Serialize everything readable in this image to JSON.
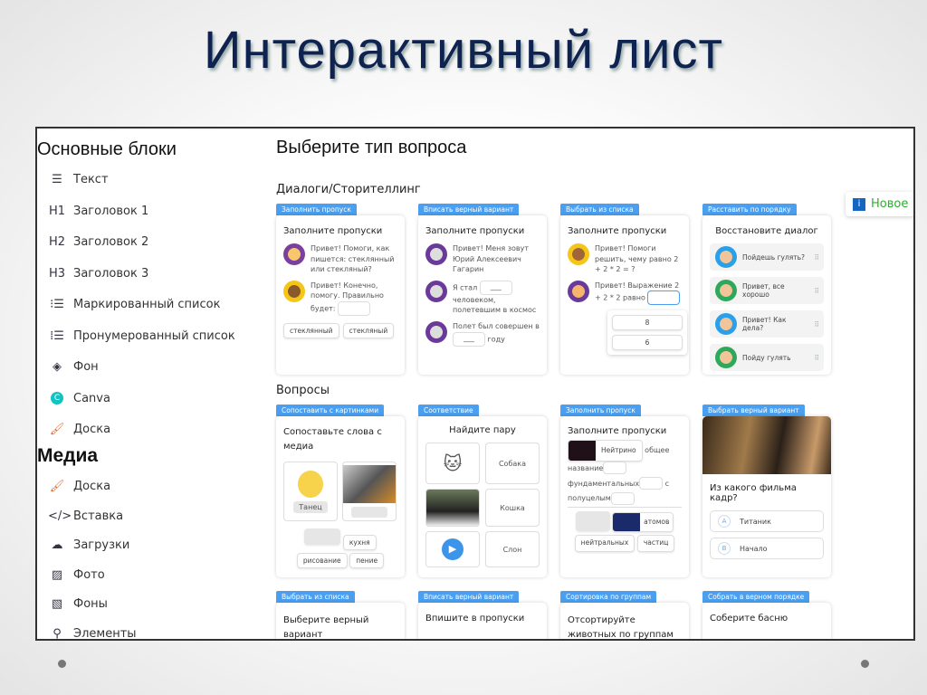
{
  "slide_title": "Интерактивный лист",
  "sidebar": {
    "basic_heading": "Основные блоки",
    "basic_items": [
      {
        "icon": "text-align-icon",
        "glyph": "☰",
        "label": "Текст"
      },
      {
        "icon": "h1-icon",
        "glyph": "H1",
        "label": "Заголовок 1"
      },
      {
        "icon": "h2-icon",
        "glyph": "H2",
        "label": "Заголовок 2"
      },
      {
        "icon": "h3-icon",
        "glyph": "H3",
        "label": "Заголовок 3"
      },
      {
        "icon": "bullet-list-icon",
        "glyph": "⁝☰",
        "label": "Маркированный список"
      },
      {
        "icon": "numbered-list-icon",
        "glyph": "⁞☰",
        "label": "Пронумерованный список"
      },
      {
        "icon": "paint-bucket-icon",
        "glyph": "◈",
        "label": "Фон"
      },
      {
        "icon": "canva-icon",
        "glyph": "C",
        "label": "Canva"
      },
      {
        "icon": "brush-icon",
        "glyph": "🖌",
        "label": "Доска"
      }
    ],
    "media_heading": "Медиа",
    "media_items": [
      {
        "icon": "brush-icon",
        "glyph": "🖌",
        "label": "Доска"
      },
      {
        "icon": "embed-code-icon",
        "glyph": "</>",
        "label": "Вставка"
      },
      {
        "icon": "cloud-upload-icon",
        "glyph": "☁",
        "label": "Загрузки"
      },
      {
        "icon": "photo-icon",
        "glyph": "▨",
        "label": "Фото"
      },
      {
        "icon": "stripes-icon",
        "glyph": "▧",
        "label": "Фоны"
      },
      {
        "icon": "elements-icon",
        "glyph": "⚲",
        "label": "Элементы"
      }
    ]
  },
  "main": {
    "title": "Выберите тип вопроса",
    "section_dialogs": "Диалоги/Сторителлинг",
    "section_questions": "Вопросы",
    "new_badge": "Новое",
    "new_badge_icon": "i",
    "cards": {
      "c1": {
        "tab": "Заполнить пропуск",
        "title": "Заполните пропуски",
        "msg1": "Привет! Помоги, как пишется: стеклянный или стекляный?",
        "msg2": "Привет! Конечно, помогу. Правильно будет:",
        "chips": [
          "стеклянный",
          "стекляный"
        ]
      },
      "c2": {
        "tab": "Вписать верный вариант",
        "title": "Заполните пропуски",
        "msg1": "Привет! Меня зовут Юрий Алексеевич Гагарин",
        "msg2a": "Я стал",
        "msg2b": "человеком, полетевшим в космос",
        "msg3a": "Полет был совершен в",
        "msg3b": "году",
        "blank": "___"
      },
      "c3": {
        "tab": "Выбрать из списка",
        "title": "Заполните пропуски",
        "msg1": "Привет! Помоги решить, чему равно 2 + 2 * 2 = ?",
        "msg2": "Привет! Выражение 2 + 2 * 2 равно",
        "options": [
          "8",
          "6"
        ]
      },
      "c4": {
        "tab": "Расставить по порядку",
        "title": "Восстановите диалог",
        "lines": [
          "Пойдешь гулять?",
          "Привет, все хорошо",
          "Привет! Как дела?",
          "Пойду гулять"
        ]
      },
      "c5": {
        "tab": "Сопоставить с картинками",
        "title": "Сопоставьте слова с медиа",
        "img_label": "Танец",
        "chips": [
          "кухня",
          "рисование",
          "пение"
        ]
      },
      "c6": {
        "tab": "Соответствие",
        "title": "Найдите пару",
        "words": [
          "Собака",
          "Кошка",
          "Слон"
        ]
      },
      "c7": {
        "tab": "Заполнить пропуск",
        "title": "Заполните пропуски",
        "chip1": "Нейтрино",
        "t1": "общее",
        "t2": "название",
        "t3": "фундаментальных",
        "t4": "с",
        "t5": "полуцелым",
        "chip2": "атомов",
        "chip3": "нейтральных",
        "chip4": "частиц"
      },
      "c8": {
        "tab": "Выбрать верный вариант",
        "title": "Из какого фильма кадр?",
        "options": [
          {
            "letter": "A",
            "label": "Титаник"
          },
          {
            "letter": "B",
            "label": "Начало"
          }
        ]
      },
      "c9": {
        "tab": "Выбрать из списка",
        "title": "Выберите верный вариант"
      },
      "c10": {
        "tab": "Вписать верный вариант",
        "title": "Впишите в пропуски"
      },
      "c11": {
        "tab": "Сортировка по группам",
        "title": "Отсортируйте животных по группам"
      },
      "c12": {
        "tab": "Собрать в верном порядке",
        "title": "Соберите басню"
      }
    }
  },
  "colors": {
    "tab_blue": "#4a9ff0",
    "title_navy": "#0f2350",
    "new_green": "#2ab12a"
  }
}
